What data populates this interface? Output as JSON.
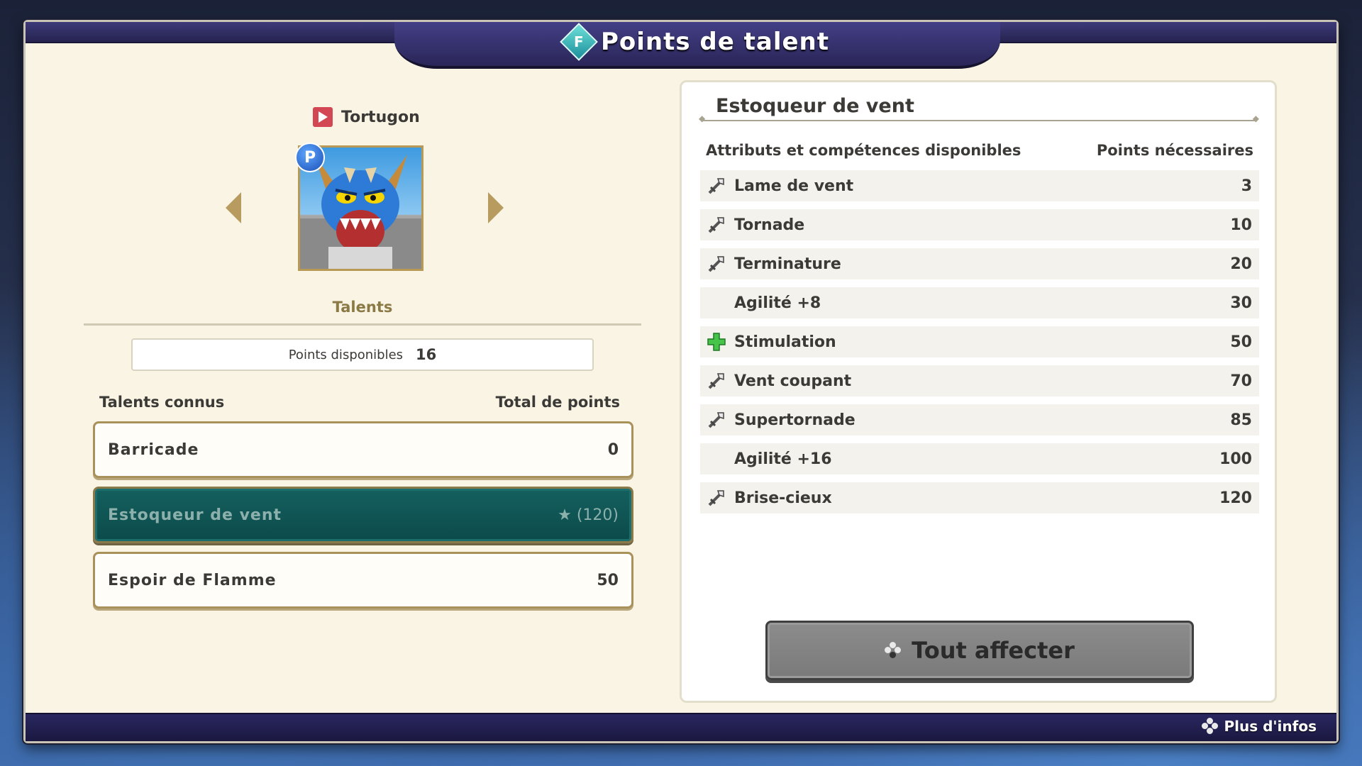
{
  "header": {
    "title": "Points de talent",
    "icon": "talent-diamond-icon"
  },
  "character": {
    "name": "Tortugon",
    "flag_icon": "red-flag-icon",
    "badge": "P"
  },
  "talents": {
    "heading": "Talents",
    "points_label": "Points disponibles",
    "points_value": "16",
    "col_known": "Talents connus",
    "col_total": "Total de points",
    "rows": [
      {
        "name": "Barricade",
        "value": "0",
        "selected": false
      },
      {
        "name": "Estoqueur de vent",
        "value": "★ (120)",
        "selected": true
      },
      {
        "name": "Espoir de Flamme",
        "value": "50",
        "selected": false
      }
    ]
  },
  "detail": {
    "title": "Estoqueur de vent",
    "col_skills": "Attributs et compétences disponibles",
    "col_points": "Points nécessaires",
    "skills": [
      {
        "name": "Lame de vent",
        "points": "3",
        "icon": "sword-icon"
      },
      {
        "name": "Tornade",
        "points": "10",
        "icon": "sword-icon"
      },
      {
        "name": "Terminature",
        "points": "20",
        "icon": "sword-icon"
      },
      {
        "name": "Agilité +8",
        "points": "30",
        "icon": ""
      },
      {
        "name": "Stimulation",
        "points": "50",
        "icon": "green-cross-icon"
      },
      {
        "name": "Vent coupant",
        "points": "70",
        "icon": "sword-icon"
      },
      {
        "name": "Supertornade",
        "points": "85",
        "icon": "sword-icon"
      },
      {
        "name": "Agilité +16",
        "points": "100",
        "icon": ""
      },
      {
        "name": "Brise-cieux",
        "points": "120",
        "icon": "sword-icon"
      }
    ],
    "assign_button": "Tout affecter"
  },
  "footer": {
    "info_label": "Plus d'infos"
  },
  "colors": {
    "selected_row": "#0e5251",
    "frame_bar": "#2a2658",
    "accent_gold": "#b89b5e"
  }
}
